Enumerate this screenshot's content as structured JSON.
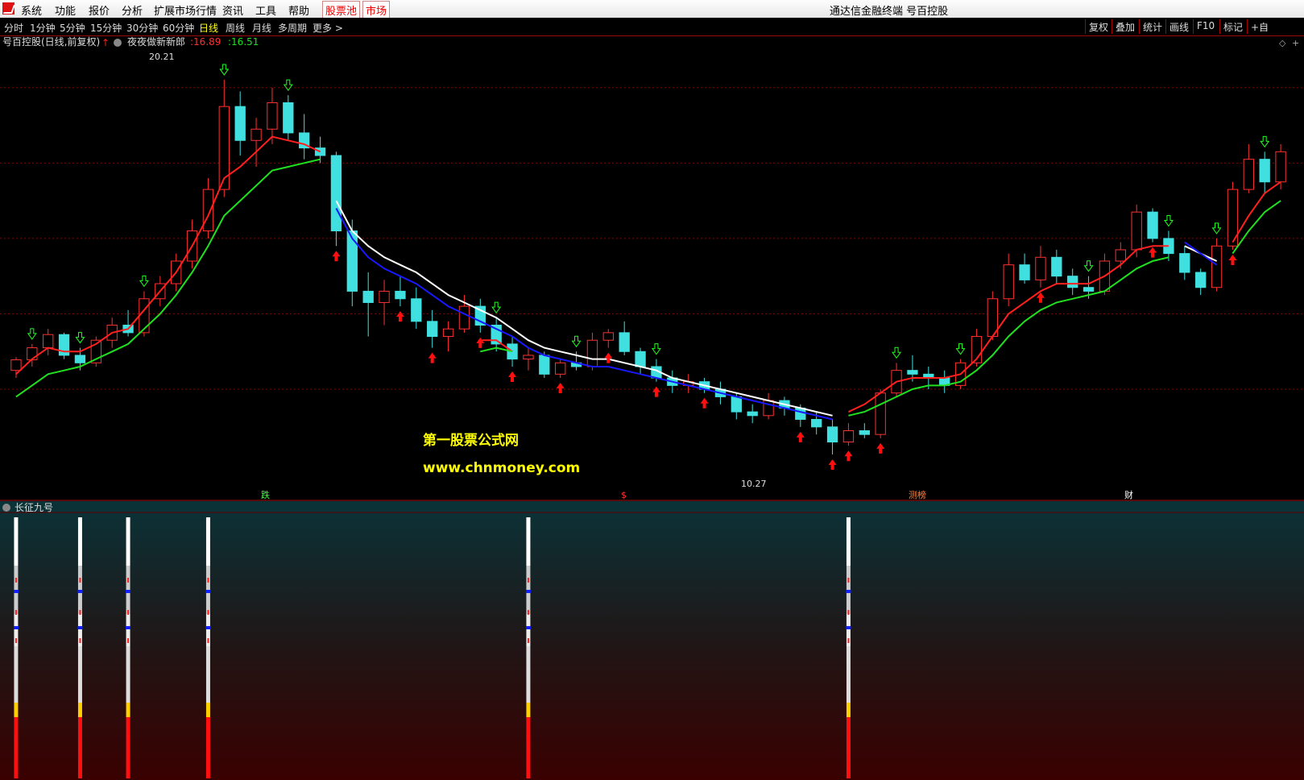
{
  "menubar": {
    "items": [
      "系统",
      "功能",
      "报价",
      "分析",
      "扩展市场行情",
      "资讯",
      "工具",
      "帮助"
    ],
    "highlight_items": [
      "股票池",
      "市场"
    ],
    "window_title": "通达信金融终端 号百控股"
  },
  "toolbar": {
    "periods": [
      "分时",
      "1分钟",
      "5分钟",
      "15分钟",
      "30分钟",
      "60分钟",
      "日线",
      "周线",
      "月线",
      "多周期",
      "更多 >"
    ],
    "active_period": "日线",
    "right_buttons": [
      "复权",
      "叠加",
      "统计",
      "画线",
      "F10",
      "标记",
      "+自"
    ]
  },
  "main_chart": {
    "title": "号百控股(日线,前复权)",
    "indicator_name": "夜夜做新新郎",
    "value_red": ":16.89",
    "value_green": ":16.51",
    "max_label": "20.21",
    "min_label": "10.27",
    "watermark_line1": "第一股票公式网",
    "watermark_line2": "www.chnmoney.com",
    "bottom_tags": [
      "跌",
      "$",
      "测榜",
      "财"
    ]
  },
  "sub_chart": {
    "title": "长征九号"
  },
  "colors": {
    "up": "#ff3030",
    "down": "#40e0e0",
    "highlight": "#ffff40",
    "ma_red": "#ff2020",
    "ma_green": "#20e020",
    "ma_white": "#ffffff",
    "ma_blue": "#1818ff",
    "grid": "#8a0000"
  },
  "chart_data": {
    "type": "candlestick",
    "title": "号百控股(日线,前复权)",
    "ylim": [
      9.5,
      21.0
    ],
    "price_max": 20.21,
    "price_min": 10.27,
    "candles_ohlc": [
      [
        12.5,
        12.85,
        12.3,
        12.78
      ],
      [
        12.78,
        13.2,
        12.6,
        13.1
      ],
      [
        13.1,
        13.6,
        12.9,
        13.45
      ],
      [
        13.45,
        13.5,
        12.8,
        12.9
      ],
      [
        12.9,
        13.1,
        12.5,
        12.7
      ],
      [
        12.7,
        13.4,
        12.6,
        13.3
      ],
      [
        13.3,
        13.9,
        13.1,
        13.7
      ],
      [
        13.7,
        14.1,
        13.4,
        13.5
      ],
      [
        13.5,
        14.6,
        13.4,
        14.4
      ],
      [
        14.4,
        15.0,
        14.2,
        14.8
      ],
      [
        14.8,
        15.6,
        14.6,
        15.4
      ],
      [
        15.4,
        16.5,
        15.2,
        16.2
      ],
      [
        16.2,
        17.6,
        16.0,
        17.3
      ],
      [
        17.3,
        20.21,
        17.1,
        19.5
      ],
      [
        19.5,
        19.9,
        18.2,
        18.6
      ],
      [
        18.6,
        19.2,
        17.9,
        18.9
      ],
      [
        18.9,
        20.0,
        18.5,
        19.6
      ],
      [
        19.6,
        19.8,
        18.6,
        18.8
      ],
      [
        18.8,
        19.3,
        18.1,
        18.4
      ],
      [
        18.4,
        18.7,
        18.0,
        18.2
      ],
      [
        18.2,
        18.3,
        15.8,
        16.2
      ],
      [
        16.2,
        16.5,
        14.2,
        14.6
      ],
      [
        14.6,
        15.1,
        13.4,
        14.3
      ],
      [
        14.3,
        14.9,
        13.7,
        14.6
      ],
      [
        14.6,
        15.0,
        14.2,
        14.4
      ],
      [
        14.4,
        14.7,
        13.6,
        13.8
      ],
      [
        13.8,
        14.1,
        13.1,
        13.4
      ],
      [
        13.4,
        13.8,
        13.0,
        13.6
      ],
      [
        13.6,
        14.5,
        13.5,
        14.2
      ],
      [
        14.2,
        14.4,
        13.5,
        13.7
      ],
      [
        13.7,
        13.9,
        13.0,
        13.2
      ],
      [
        13.2,
        13.4,
        12.6,
        12.8
      ],
      [
        12.8,
        13.1,
        12.5,
        12.9
      ],
      [
        12.9,
        13.0,
        12.3,
        12.4
      ],
      [
        12.4,
        12.8,
        12.3,
        12.7
      ],
      [
        12.7,
        13.0,
        12.5,
        12.6
      ],
      [
        12.6,
        13.5,
        12.5,
        13.3
      ],
      [
        13.3,
        13.6,
        13.1,
        13.5
      ],
      [
        13.5,
        13.8,
        12.9,
        13.0
      ],
      [
        13.0,
        13.1,
        12.4,
        12.6
      ],
      [
        12.6,
        12.8,
        12.2,
        12.3
      ],
      [
        12.3,
        12.5,
        11.9,
        12.1
      ],
      [
        12.1,
        12.4,
        11.9,
        12.2
      ],
      [
        12.2,
        12.3,
        11.9,
        12.0
      ],
      [
        12.0,
        12.2,
        11.6,
        11.8
      ],
      [
        11.8,
        11.9,
        11.2,
        11.4
      ],
      [
        11.4,
        11.6,
        11.1,
        11.3
      ],
      [
        11.3,
        11.9,
        11.2,
        11.7
      ],
      [
        11.7,
        11.8,
        11.3,
        11.5
      ],
      [
        11.5,
        11.6,
        11.0,
        11.2
      ],
      [
        11.2,
        11.4,
        10.8,
        11.0
      ],
      [
        11.0,
        11.2,
        10.27,
        10.6
      ],
      [
        10.6,
        11.1,
        10.5,
        10.9
      ],
      [
        10.9,
        11.1,
        10.7,
        10.8
      ],
      [
        10.8,
        12.0,
        10.7,
        11.9
      ],
      [
        11.9,
        12.7,
        11.8,
        12.5
      ],
      [
        12.5,
        12.9,
        12.2,
        12.4
      ],
      [
        12.4,
        12.6,
        12.0,
        12.3
      ],
      [
        12.3,
        12.5,
        11.9,
        12.1
      ],
      [
        12.1,
        12.8,
        12.0,
        12.7
      ],
      [
        12.7,
        13.6,
        12.6,
        13.4
      ],
      [
        13.4,
        14.6,
        13.3,
        14.4
      ],
      [
        14.4,
        15.6,
        14.2,
        15.3
      ],
      [
        15.3,
        15.6,
        14.8,
        14.9
      ],
      [
        14.9,
        15.8,
        14.7,
        15.5
      ],
      [
        15.5,
        15.7,
        14.8,
        15.0
      ],
      [
        15.0,
        15.2,
        14.5,
        14.7
      ],
      [
        14.7,
        15.0,
        14.4,
        14.6
      ],
      [
        14.6,
        15.6,
        14.5,
        15.4
      ],
      [
        15.4,
        15.9,
        15.2,
        15.7
      ],
      [
        15.7,
        16.9,
        15.5,
        16.7
      ],
      [
        16.7,
        16.8,
        15.9,
        16.0
      ],
      [
        16.0,
        16.2,
        15.4,
        15.6
      ],
      [
        15.6,
        15.8,
        14.9,
        15.1
      ],
      [
        15.1,
        15.2,
        14.5,
        14.7
      ],
      [
        14.7,
        16.0,
        14.6,
        15.8
      ],
      [
        15.8,
        17.5,
        15.7,
        17.3
      ],
      [
        17.3,
        18.5,
        17.2,
        18.1
      ],
      [
        18.1,
        18.3,
        17.2,
        17.5
      ],
      [
        17.5,
        18.5,
        17.3,
        18.3
      ]
    ],
    "ma_series": [
      {
        "name": "white",
        "color": "#ffffff",
        "values": [
          null,
          null,
          null,
          null,
          null,
          null,
          null,
          null,
          null,
          null,
          null,
          null,
          null,
          null,
          null,
          null,
          null,
          null,
          null,
          null,
          17.0,
          16.2,
          15.8,
          15.5,
          15.3,
          15.1,
          14.8,
          14.5,
          14.3,
          14.1,
          13.9,
          13.6,
          13.3,
          13.1,
          13.0,
          12.9,
          12.8,
          12.8,
          12.7,
          12.6,
          12.5,
          12.3,
          12.2,
          12.1,
          12.0,
          11.9,
          11.8,
          11.7,
          11.6,
          11.5,
          11.4,
          11.3,
          null,
          null,
          null,
          null,
          null,
          null,
          null,
          null,
          null,
          null,
          null,
          null,
          null,
          null,
          null,
          null,
          null,
          null,
          null,
          null,
          null,
          15.8,
          15.6,
          15.4,
          null,
          null,
          null,
          null
        ]
      },
      {
        "name": "blue",
        "color": "#1818ff",
        "values": [
          null,
          null,
          null,
          null,
          null,
          null,
          null,
          null,
          null,
          null,
          null,
          null,
          null,
          null,
          null,
          null,
          null,
          null,
          null,
          null,
          16.8,
          16.0,
          15.5,
          15.2,
          15.0,
          14.8,
          14.5,
          14.2,
          14.0,
          13.8,
          13.6,
          13.4,
          13.1,
          12.9,
          12.8,
          12.7,
          12.6,
          12.6,
          12.5,
          12.4,
          12.3,
          12.2,
          12.1,
          12.0,
          11.9,
          11.8,
          11.7,
          11.6,
          11.5,
          11.4,
          11.3,
          11.2,
          null,
          null,
          null,
          null,
          null,
          null,
          null,
          null,
          null,
          null,
          null,
          null,
          null,
          null,
          null,
          null,
          null,
          null,
          null,
          null,
          null,
          15.9,
          15.6,
          15.3,
          null,
          null,
          null,
          null
        ]
      },
      {
        "name": "red",
        "color": "#ff2020",
        "values": [
          12.4,
          12.8,
          13.1,
          13.0,
          13.0,
          13.2,
          13.5,
          13.6,
          14.1,
          14.6,
          15.1,
          15.8,
          16.6,
          17.6,
          17.9,
          18.3,
          18.7,
          18.6,
          18.5,
          18.3,
          null,
          null,
          null,
          null,
          null,
          null,
          null,
          null,
          null,
          13.3,
          13.3,
          13.0,
          null,
          null,
          null,
          null,
          null,
          null,
          null,
          null,
          null,
          null,
          null,
          null,
          null,
          null,
          null,
          null,
          null,
          null,
          null,
          null,
          11.4,
          11.6,
          11.9,
          12.2,
          12.3,
          12.3,
          12.3,
          12.4,
          12.8,
          13.4,
          14.0,
          14.3,
          14.6,
          14.8,
          14.8,
          14.8,
          15.0,
          15.3,
          15.7,
          15.8,
          15.8,
          null,
          null,
          null,
          15.9,
          16.6,
          17.2,
          17.5
        ]
      },
      {
        "name": "green",
        "color": "#20e020",
        "values": [
          11.8,
          12.1,
          12.4,
          12.5,
          12.6,
          12.8,
          13.0,
          13.2,
          13.6,
          14.0,
          14.5,
          15.1,
          15.8,
          16.6,
          17.0,
          17.4,
          17.8,
          17.9,
          18.0,
          18.1,
          null,
          null,
          null,
          null,
          null,
          null,
          null,
          null,
          null,
          13.0,
          13.1,
          13.0,
          null,
          null,
          null,
          null,
          null,
          null,
          null,
          null,
          null,
          null,
          null,
          null,
          null,
          null,
          null,
          null,
          null,
          null,
          null,
          null,
          11.3,
          11.4,
          11.6,
          11.8,
          12.0,
          12.1,
          12.1,
          12.2,
          12.5,
          12.9,
          13.4,
          13.8,
          14.1,
          14.3,
          14.4,
          14.5,
          14.6,
          14.9,
          15.2,
          15.4,
          15.5,
          null,
          null,
          null,
          15.6,
          16.2,
          16.7,
          17.0
        ]
      }
    ],
    "buy_arrows": [
      20,
      24,
      26,
      29,
      31,
      34,
      37,
      40,
      43,
      49,
      51,
      52,
      54,
      64,
      71,
      76
    ],
    "sell_arrows": [
      1,
      4,
      8,
      13,
      17,
      30,
      35,
      40,
      55,
      59,
      67,
      72,
      75,
      78
    ],
    "sub_signal_candles": [
      0,
      4,
      7,
      12,
      32,
      52
    ]
  }
}
